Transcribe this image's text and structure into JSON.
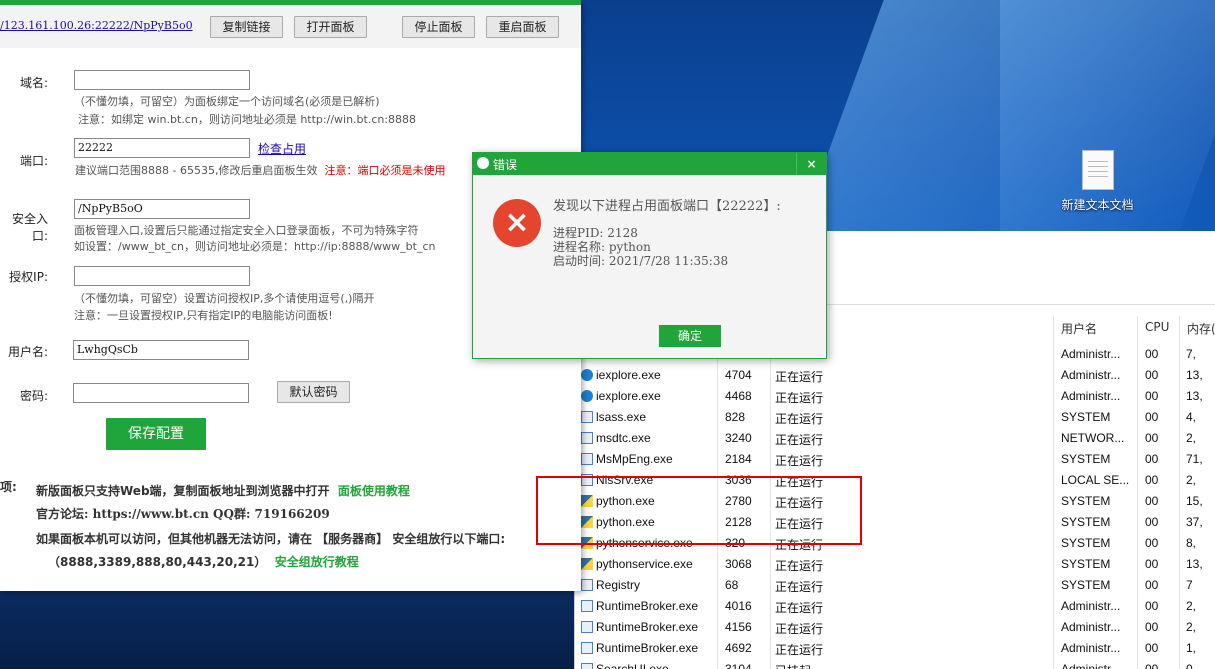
{
  "desktop": {
    "icon_label": "新建文本文档"
  },
  "panel": {
    "url": "/123.161.100.26:22222/NpPyB5o0",
    "buttons": {
      "copy": "复制链接",
      "open": "打开面板",
      "stop": "停止面板",
      "restart": "重启面板"
    },
    "domain": {
      "label": "域名:",
      "value": "",
      "hint1": "（不懂勿填，可留空）为面板绑定一个访问域名(必须是已解析)",
      "hint2": "注意：如绑定 win.bt.cn，则访问地址必须是 http://win.bt.cn:8888"
    },
    "port": {
      "label": "端口:",
      "value": "22222",
      "check_link": "检查占用",
      "hint": "建议端口范围8888 - 65535,修改后重启面板生效",
      "warn": "注意：端口必须是未使用"
    },
    "entry": {
      "label": "安全入口:",
      "value": "/NpPyB5oO",
      "hint1": "面板管理入口,设置后只能通过指定安全入口登录面板，不可为特殊字符",
      "hint2": "如设置：/www_bt_cn，则访问地址必须是：http://ip:8888/www_bt_cn"
    },
    "ip": {
      "label": "授权IP:",
      "value": "",
      "hint1": "（不懂勿填，可留空）设置访问授权IP,多个请使用逗号(,)隔开",
      "hint2": "注意：一旦设置授权IP,只有指定IP的电脑能访问面板!"
    },
    "user": {
      "label": "用户名:",
      "value": "LwhgQsCb"
    },
    "pass": {
      "label": "密码:",
      "value": "",
      "default_btn": "默认密码"
    },
    "save": "保存配置",
    "notice": {
      "prefix": "项:",
      "line1": "新版面板只支持Web端，复制面板地址到浏览器中打开",
      "line1_link": "面板使用教程",
      "line2": "官方论坛: https://www.bt.cn  QQ群: 719166209",
      "line3": "如果面板本机可以访问，但其他机器无法访问，请在 【服务器商】 安全组放行以下端口:",
      "line4": "（8888,3389,888,80,443,20,21）",
      "line4_link": "安全组放行教程"
    }
  },
  "dialog": {
    "title": "错误",
    "close": "×",
    "icon": "×",
    "line1": "发现以下进程占用面板端口【22222】:",
    "line2": "进程PID: 2128",
    "line3": "进程名称: python",
    "line4": "启动时间: 2021/7/28 11:35:38",
    "ok": "确定"
  },
  "taskmgr": {
    "headers": {
      "user": "用户名",
      "cpu": "CPU",
      "mem": "内存("
    },
    "rows": [
      {
        "name": "",
        "pid": "",
        "status": "",
        "user": "Administr...",
        "cpu": "00",
        "mem": "7,"
      },
      {
        "name": "iexplore.exe",
        "pid": "4704",
        "status": "正在运行",
        "user": "Administr...",
        "cpu": "00",
        "mem": "13,"
      },
      {
        "name": "iexplore.exe",
        "pid": "4468",
        "status": "正在运行",
        "user": "Administr...",
        "cpu": "00",
        "mem": "13,"
      },
      {
        "name": "lsass.exe",
        "pid": "828",
        "status": "正在运行",
        "user": "SYSTEM",
        "cpu": "00",
        "mem": "4,"
      },
      {
        "name": "msdtc.exe",
        "pid": "3240",
        "status": "正在运行",
        "user": "NETWOR...",
        "cpu": "00",
        "mem": "2,"
      },
      {
        "name": "MsMpEng.exe",
        "pid": "2184",
        "status": "正在运行",
        "user": "SYSTEM",
        "cpu": "00",
        "mem": "71,"
      },
      {
        "name": "NisSrv.exe",
        "pid": "3036",
        "status": "正在运行",
        "user": "LOCAL SE...",
        "cpu": "00",
        "mem": "2,"
      },
      {
        "name": "python.exe",
        "pid": "2780",
        "status": "正在运行",
        "user": "SYSTEM",
        "cpu": "00",
        "mem": "15,"
      },
      {
        "name": "python.exe",
        "pid": "2128",
        "status": "正在运行",
        "user": "SYSTEM",
        "cpu": "00",
        "mem": "37,"
      },
      {
        "name": "pythonservice.exe",
        "pid": "320",
        "status": "正在运行",
        "user": "SYSTEM",
        "cpu": "00",
        "mem": "8,"
      },
      {
        "name": "pythonservice.exe",
        "pid": "3068",
        "status": "正在运行",
        "user": "SYSTEM",
        "cpu": "00",
        "mem": "13,"
      },
      {
        "name": "Registry",
        "pid": "68",
        "status": "正在运行",
        "user": "SYSTEM",
        "cpu": "00",
        "mem": "7"
      },
      {
        "name": "RuntimeBroker.exe",
        "pid": "4016",
        "status": "正在运行",
        "user": "Administr...",
        "cpu": "00",
        "mem": "2,"
      },
      {
        "name": "RuntimeBroker.exe",
        "pid": "4156",
        "status": "正在运行",
        "user": "Administr...",
        "cpu": "00",
        "mem": "2,"
      },
      {
        "name": "RuntimeBroker.exe",
        "pid": "4692",
        "status": "正在运行",
        "user": "Administr...",
        "cpu": "00",
        "mem": "1,"
      },
      {
        "name": "SearchUI.exe",
        "pid": "3104",
        "status": "已挂起",
        "user": "Administr...",
        "cpu": "00",
        "mem": "0"
      }
    ]
  }
}
